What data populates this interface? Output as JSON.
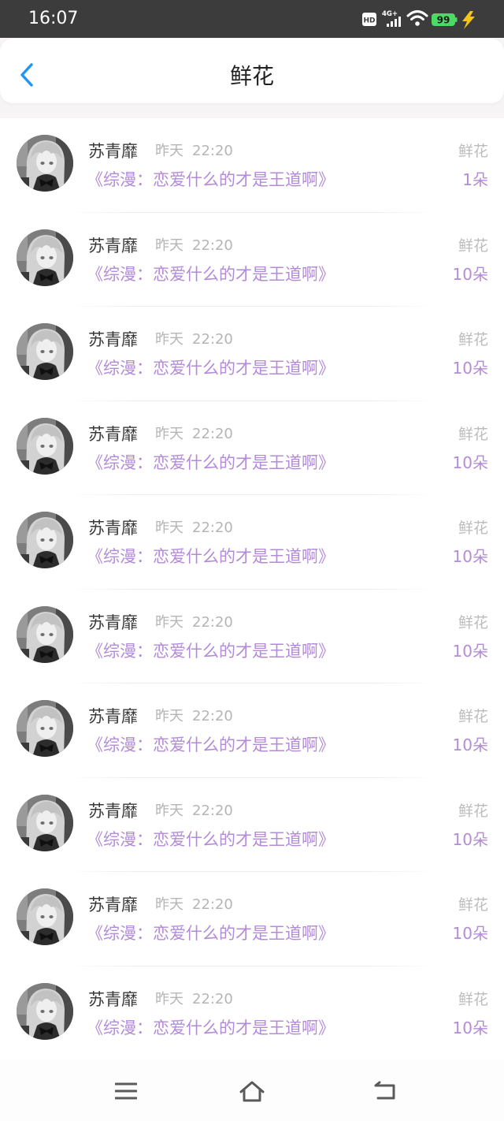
{
  "status_bar": {
    "time": "16:07",
    "hd_label": "HD",
    "network_label": "4G+",
    "battery_level": "99",
    "icons": [
      "hd-icon",
      "signal-icon",
      "wifi-icon",
      "battery-icon",
      "charging-icon"
    ]
  },
  "header": {
    "title": "鲜花",
    "back_icon": "chevron-left-icon"
  },
  "items": [
    {
      "name": "苏青靡",
      "date": "昨天",
      "time": "22:20",
      "book": "《综漫：恋爱什么的才是王道啊》",
      "gift": "鲜花",
      "count": "1朵"
    },
    {
      "name": "苏青靡",
      "date": "昨天",
      "time": "22:20",
      "book": "《综漫：恋爱什么的才是王道啊》",
      "gift": "鲜花",
      "count": "10朵"
    },
    {
      "name": "苏青靡",
      "date": "昨天",
      "time": "22:20",
      "book": "《综漫：恋爱什么的才是王道啊》",
      "gift": "鲜花",
      "count": "10朵"
    },
    {
      "name": "苏青靡",
      "date": "昨天",
      "time": "22:20",
      "book": "《综漫：恋爱什么的才是王道啊》",
      "gift": "鲜花",
      "count": "10朵"
    },
    {
      "name": "苏青靡",
      "date": "昨天",
      "time": "22:20",
      "book": "《综漫：恋爱什么的才是王道啊》",
      "gift": "鲜花",
      "count": "10朵"
    },
    {
      "name": "苏青靡",
      "date": "昨天",
      "time": "22:20",
      "book": "《综漫：恋爱什么的才是王道啊》",
      "gift": "鲜花",
      "count": "10朵"
    },
    {
      "name": "苏青靡",
      "date": "昨天",
      "time": "22:20",
      "book": "《综漫：恋爱什么的才是王道啊》",
      "gift": "鲜花",
      "count": "10朵"
    },
    {
      "name": "苏青靡",
      "date": "昨天",
      "time": "22:20",
      "book": "《综漫：恋爱什么的才是王道啊》",
      "gift": "鲜花",
      "count": "10朵"
    },
    {
      "name": "苏青靡",
      "date": "昨天",
      "time": "22:20",
      "book": "《综漫：恋爱什么的才是王道啊》",
      "gift": "鲜花",
      "count": "10朵"
    },
    {
      "name": "苏青靡",
      "date": "昨天",
      "time": "22:20",
      "book": "《综漫：恋爱什么的才是王道啊》",
      "gift": "鲜花",
      "count": "10朵"
    }
  ],
  "nav": {
    "icons": [
      "menu-icon",
      "home-icon",
      "back-icon"
    ]
  },
  "colors": {
    "accent": "#b38bd9",
    "back_button": "#2196f3",
    "status_bar": "#3c3c3c",
    "battery": "#4cd964",
    "charging": "#f5c518"
  }
}
